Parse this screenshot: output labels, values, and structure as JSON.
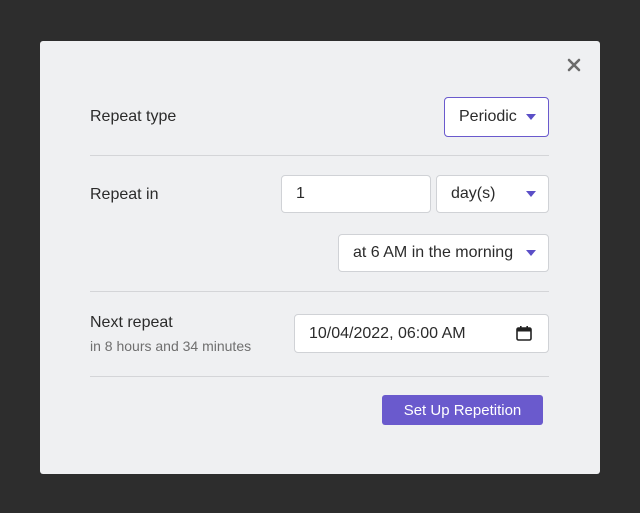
{
  "dialog": {
    "close_icon": "close-icon",
    "repeat_type": {
      "label": "Repeat type",
      "selected": "Periodic"
    },
    "repeat_in": {
      "label": "Repeat in",
      "amount": "1",
      "unit": "day(s)",
      "time_of_day": "at 6 AM in the morning"
    },
    "next_repeat": {
      "label": "Next repeat",
      "relative": "in 8 hours and 34 minutes",
      "datetime": "10/04/2022, 06:00 AM",
      "calendar_icon": "calendar-icon"
    },
    "submit_label": "Set Up Repetition"
  },
  "colors": {
    "background": "#2d2d2d",
    "dialog": "#eff0f2",
    "accent": "#6a5acd"
  }
}
